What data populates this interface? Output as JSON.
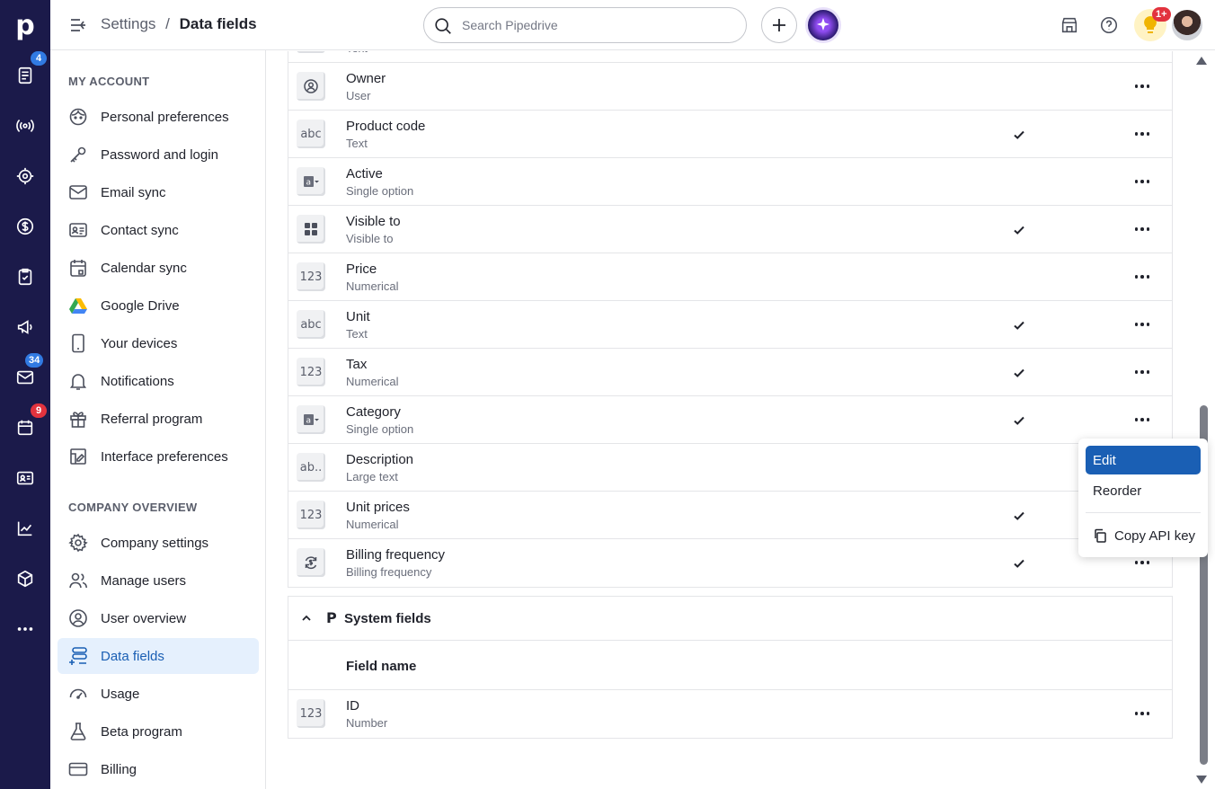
{
  "rail": {
    "logo": "p",
    "badges": {
      "leads": "4",
      "mail": "34",
      "calendar": "9"
    }
  },
  "topbar": {
    "breadcrumb_parent": "Settings",
    "breadcrumb_sep": "/",
    "breadcrumb_current": "Data fields",
    "search_placeholder": "Search Pipedrive",
    "notification_badge": "1+"
  },
  "sidebar": {
    "my_account_title": "MY ACCOUNT",
    "my_account_items": [
      {
        "label": "Personal preferences",
        "icon": "face-icon"
      },
      {
        "label": "Password and login",
        "icon": "key-icon"
      },
      {
        "label": "Email sync",
        "icon": "envelope-icon"
      },
      {
        "label": "Contact sync",
        "icon": "contact-card-icon"
      },
      {
        "label": "Calendar sync",
        "icon": "calendar-icon"
      },
      {
        "label": "Google Drive",
        "icon": "google-drive-icon"
      },
      {
        "label": "Your devices",
        "icon": "phone-icon"
      },
      {
        "label": "Notifications",
        "icon": "bell-icon"
      },
      {
        "label": "Referral program",
        "icon": "gift-icon"
      },
      {
        "label": "Interface preferences",
        "icon": "interface-icon"
      }
    ],
    "company_title": "COMPANY OVERVIEW",
    "company_items": [
      {
        "label": "Company settings",
        "icon": "gear-icon"
      },
      {
        "label": "Manage users",
        "icon": "users-icon"
      },
      {
        "label": "User overview",
        "icon": "user-circle-icon"
      },
      {
        "label": "Data fields",
        "icon": "data-fields-icon",
        "active": true
      },
      {
        "label": "Usage",
        "icon": "gauge-icon"
      },
      {
        "label": "Beta program",
        "icon": "flask-icon"
      },
      {
        "label": "Billing",
        "icon": "credit-card-icon"
      }
    ]
  },
  "fields": {
    "partial_row_type": "Text",
    "rows": [
      {
        "name": "Owner",
        "type": "User",
        "icon": "user-icon",
        "check": false
      },
      {
        "name": "Product code",
        "type": "Text",
        "icon": "abc",
        "check": true
      },
      {
        "name": "Active",
        "type": "Single option",
        "icon": "single-option-icon",
        "check": false
      },
      {
        "name": "Visible to",
        "type": "Visible to",
        "icon": "grid-icon",
        "check": true
      },
      {
        "name": "Price",
        "type": "Numerical",
        "icon": "123",
        "check": false
      },
      {
        "name": "Unit",
        "type": "Text",
        "icon": "abc",
        "check": true
      },
      {
        "name": "Tax",
        "type": "Numerical",
        "icon": "123",
        "check": true
      },
      {
        "name": "Category",
        "type": "Single option",
        "icon": "single-option-icon",
        "check": true
      },
      {
        "name": "Description",
        "type": "Large text",
        "icon": "ab..",
        "check": false
      },
      {
        "name": "Unit prices",
        "type": "Numerical",
        "icon": "123",
        "check": true
      },
      {
        "name": "Billing frequency",
        "type": "Billing frequency",
        "icon": "billing-cycle-icon",
        "check": true
      }
    ]
  },
  "system_fields": {
    "logo": "P",
    "title": "System fields",
    "column_header": "Field name",
    "rows": [
      {
        "name": "ID",
        "type": "Number",
        "icon": "123"
      }
    ]
  },
  "dropdown": {
    "edit": "Edit",
    "reorder": "Reorder",
    "copy_api_key": "Copy API key"
  },
  "colors": {
    "rail_bg": "#1b1a4a",
    "accent": "#1a5fb4",
    "active_bg": "#e5f0fd"
  }
}
